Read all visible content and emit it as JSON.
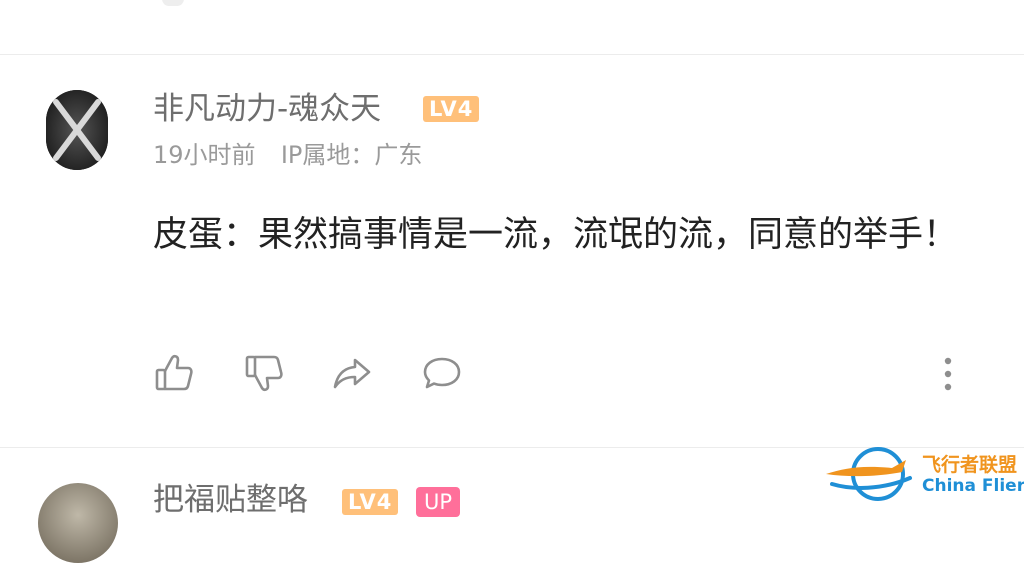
{
  "comments": [
    {
      "username": "非凡动力-魂众天",
      "level_badge": "LV4",
      "time": "19小时前",
      "ip_location": "IP属地：广东",
      "text": "皮蛋：果然搞事情是一流，流氓的流，同意的举手！",
      "actions": [
        "thumbs-up-icon",
        "thumbs-down-icon",
        "share-icon",
        "comment-icon",
        "more-vertical-icon"
      ]
    },
    {
      "username": "把福贴整咯",
      "level_badge": "LV4",
      "up_badge": "UP"
    }
  ],
  "watermark": {
    "cn": "飞行者联盟",
    "en": "China Flier"
  },
  "colors": {
    "level_badge": "#ffc07a",
    "up_badge": "#ff6f9a",
    "username": "#6e6e6e",
    "meta": "#9a9a9a"
  }
}
